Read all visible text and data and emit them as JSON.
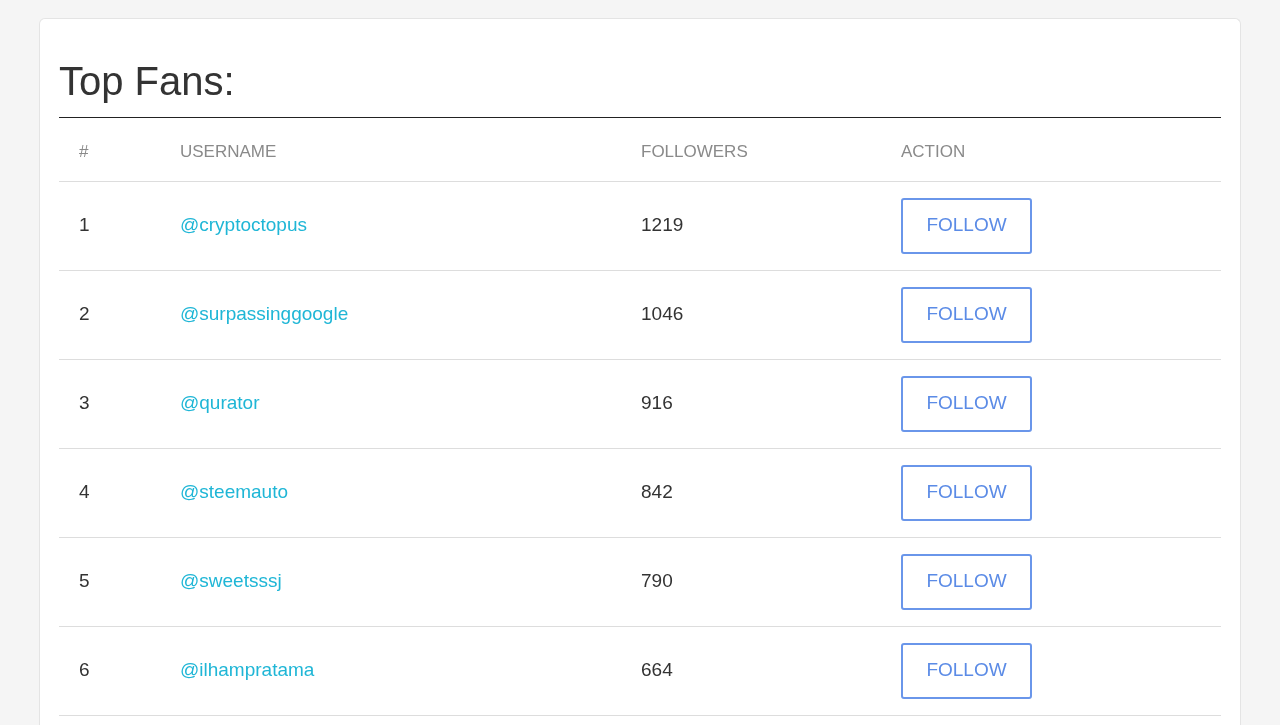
{
  "title": "Top Fans:",
  "table": {
    "columns": [
      "#",
      "USERNAME",
      "FOLLOWERS",
      "ACTION"
    ],
    "rows": [
      {
        "rank": "1",
        "username": "@cryptoctopus",
        "followers": "1219",
        "action": "FOLLOW"
      },
      {
        "rank": "2",
        "username": "@surpassinggoogle",
        "followers": "1046",
        "action": "FOLLOW"
      },
      {
        "rank": "3",
        "username": "@qurator",
        "followers": "916",
        "action": "FOLLOW"
      },
      {
        "rank": "4",
        "username": "@steemauto",
        "followers": "842",
        "action": "FOLLOW"
      },
      {
        "rank": "5",
        "username": "@sweetsssj",
        "followers": "790",
        "action": "FOLLOW"
      },
      {
        "rank": "6",
        "username": "@ilhampratama",
        "followers": "664",
        "action": "FOLLOW"
      }
    ]
  }
}
